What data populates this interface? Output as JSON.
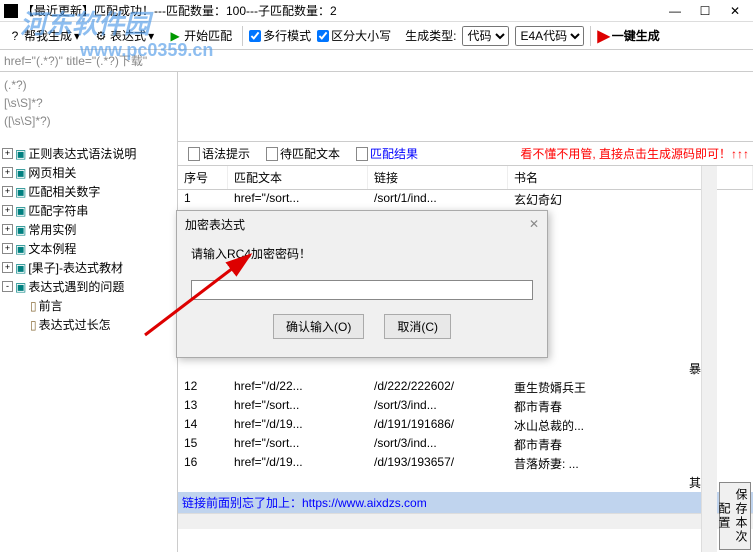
{
  "watermark": {
    "main": "河东软件园",
    "url": "www.pc0359.cn"
  },
  "titlebar": {
    "title": "【最近更新】匹配成功！---匹配数量：100---子匹配数量：2",
    "min": "—",
    "max": "☐",
    "close": "✕"
  },
  "toolbar": {
    "help": "帮我生成",
    "expr": "表达式",
    "start": "开始匹配",
    "multi": "多行模式",
    "case": "区分大小写",
    "gentype_label": "生成类型:",
    "gentype_value": "代码",
    "e4a_value": "E4A代码",
    "onekey": "一键生成"
  },
  "expr": {
    "text": "href=\"(.*?)\" title=\"(.*?)下载\""
  },
  "patterns": {
    "p1": "(.*?)",
    "p2": "[\\s\\S]*?",
    "p3": "([\\s\\S]*?)"
  },
  "tree": {
    "items": [
      "正则表达式语法说明",
      "网页相关",
      "匹配相关数字",
      "匹配字符串",
      "常用实例",
      "文本例程",
      "[果子]-表达式教材",
      "表达式遇到的问题"
    ],
    "children": [
      "前言",
      "表达式过长怎"
    ]
  },
  "tabs": {
    "t1": "语法提示",
    "t2": "待匹配文本",
    "t3": "匹配结果",
    "hint": "看不懂不用管, 直接点击生成源码即可！↑↑↑"
  },
  "table": {
    "headers": [
      "序号",
      "匹配文本",
      "链接",
      "书名"
    ],
    "first_row": [
      "1",
      "href=\"/sort...",
      "/sort/1/ind...",
      "玄幻奇幻"
    ],
    "rows": [
      [
        "12",
        "href=\"/d/22...",
        "/d/222/222602/",
        "重生贽婿兵王"
      ],
      [
        "13",
        "href=\"/sort...",
        "/sort/3/ind...",
        "都市青春"
      ],
      [
        "14",
        "href=\"/d/19...",
        "/d/191/191686/",
        "冰山总裁的..."
      ],
      [
        "15",
        "href=\"/sort...",
        "/sort/3/ind...",
        "都市青春"
      ],
      [
        "16",
        "href=\"/d/19...",
        "/d/193/193657/",
        "昔落娇妻: ..."
      ]
    ],
    "extra_cells": [
      "暴君",
      "其他"
    ],
    "footer": "链接前面别忘了加上：https://www.aixdzs.com"
  },
  "save_btn": "保存本次配置",
  "dialog": {
    "title": "加密表达式",
    "prompt": "请输入RC4加密密码！",
    "ok": "确认输入(O)",
    "cancel": "取消(C)",
    "close": "✕"
  }
}
